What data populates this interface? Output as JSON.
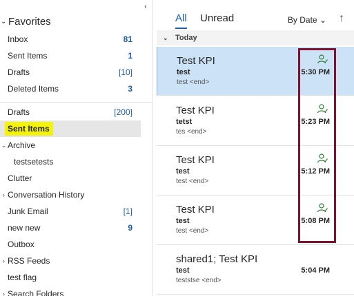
{
  "nav": {
    "favorites_label": "Favorites",
    "favorites": [
      {
        "label": "Inbox",
        "count": "81"
      },
      {
        "label": "Sent Items",
        "count": "1"
      },
      {
        "label": "Drafts",
        "count": "[10]"
      },
      {
        "label": "Deleted Items",
        "count": "3"
      }
    ],
    "folders": [
      {
        "label": "Drafts",
        "count": "[200]"
      },
      {
        "label": "Sent Items",
        "count": ""
      },
      {
        "label": "Archive",
        "count": ""
      },
      {
        "label": "testsetests",
        "count": ""
      },
      {
        "label": "Clutter",
        "count": ""
      },
      {
        "label": "Conversation History",
        "count": ""
      },
      {
        "label": "Junk Email",
        "count": "[1]"
      },
      {
        "label": "new new",
        "count": "9"
      },
      {
        "label": "Outbox",
        "count": ""
      },
      {
        "label": "RSS Feeds",
        "count": ""
      },
      {
        "label": "test flag",
        "count": ""
      },
      {
        "label": "Search Folders",
        "count": ""
      }
    ]
  },
  "list": {
    "tabs": {
      "all": "All",
      "unread": "Unread"
    },
    "sort_label": "By Date ⌄",
    "sort_arrow": "↑",
    "group_today": "Today",
    "messages": [
      {
        "sender": "Test KPI",
        "subject": "test",
        "preview": "test <end>",
        "time": "5:30 PM",
        "icon": "person-check-icon"
      },
      {
        "sender": "Test KPI",
        "subject": "tetst",
        "preview": "tes <end>",
        "time": "5:23 PM",
        "icon": "person-check-icon"
      },
      {
        "sender": "Test KPI",
        "subject": "test",
        "preview": "test <end>",
        "time": "5:12 PM",
        "icon": "person-check-icon"
      },
      {
        "sender": "Test KPI",
        "subject": "test",
        "preview": "test <end>",
        "time": "5:08 PM",
        "icon": "person-check-icon"
      },
      {
        "sender": "shared1; Test KPI",
        "subject": "test",
        "preview": "teststse <end>",
        "time": "5:04 PM",
        "icon": ""
      }
    ]
  },
  "colors": {
    "accent": "#1f5fa8",
    "selected_row": "#cce3f7",
    "highlight": "#f2f20a",
    "annotation_box": "#7b1330",
    "icon_green": "#2e7d32"
  }
}
